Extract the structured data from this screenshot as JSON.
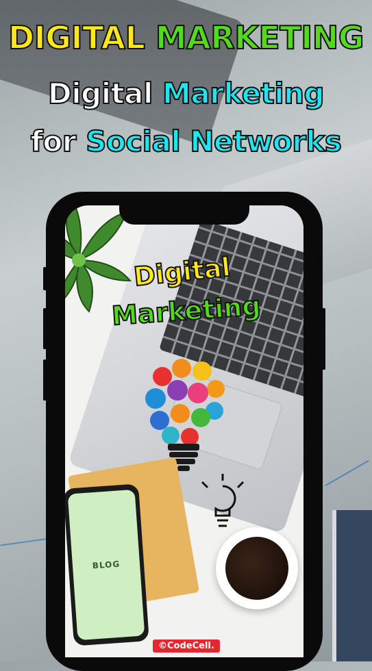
{
  "headline": {
    "line1_part1": "DIGITAL",
    "line1_part2": "MARKETING",
    "line2_part1": "Digital",
    "line2_part2": "Marketing",
    "line3_part1": "for",
    "line3_part2": "Social Networks"
  },
  "screen": {
    "title_line1": "Digital",
    "title_line2": "Marketing",
    "mini_phone_text": "BLOG",
    "copyright": "©CodeCell."
  },
  "colors": {
    "yellow": "#ffe81a",
    "green": "#54d91f",
    "cyan": "#1ee6f0",
    "white": "#ffffff",
    "badge_red": "#e4262d"
  },
  "icons": [
    "lightbulb-icon",
    "plant-icon",
    "coffee-cup-icon",
    "laptop-icon",
    "phone-icon"
  ]
}
